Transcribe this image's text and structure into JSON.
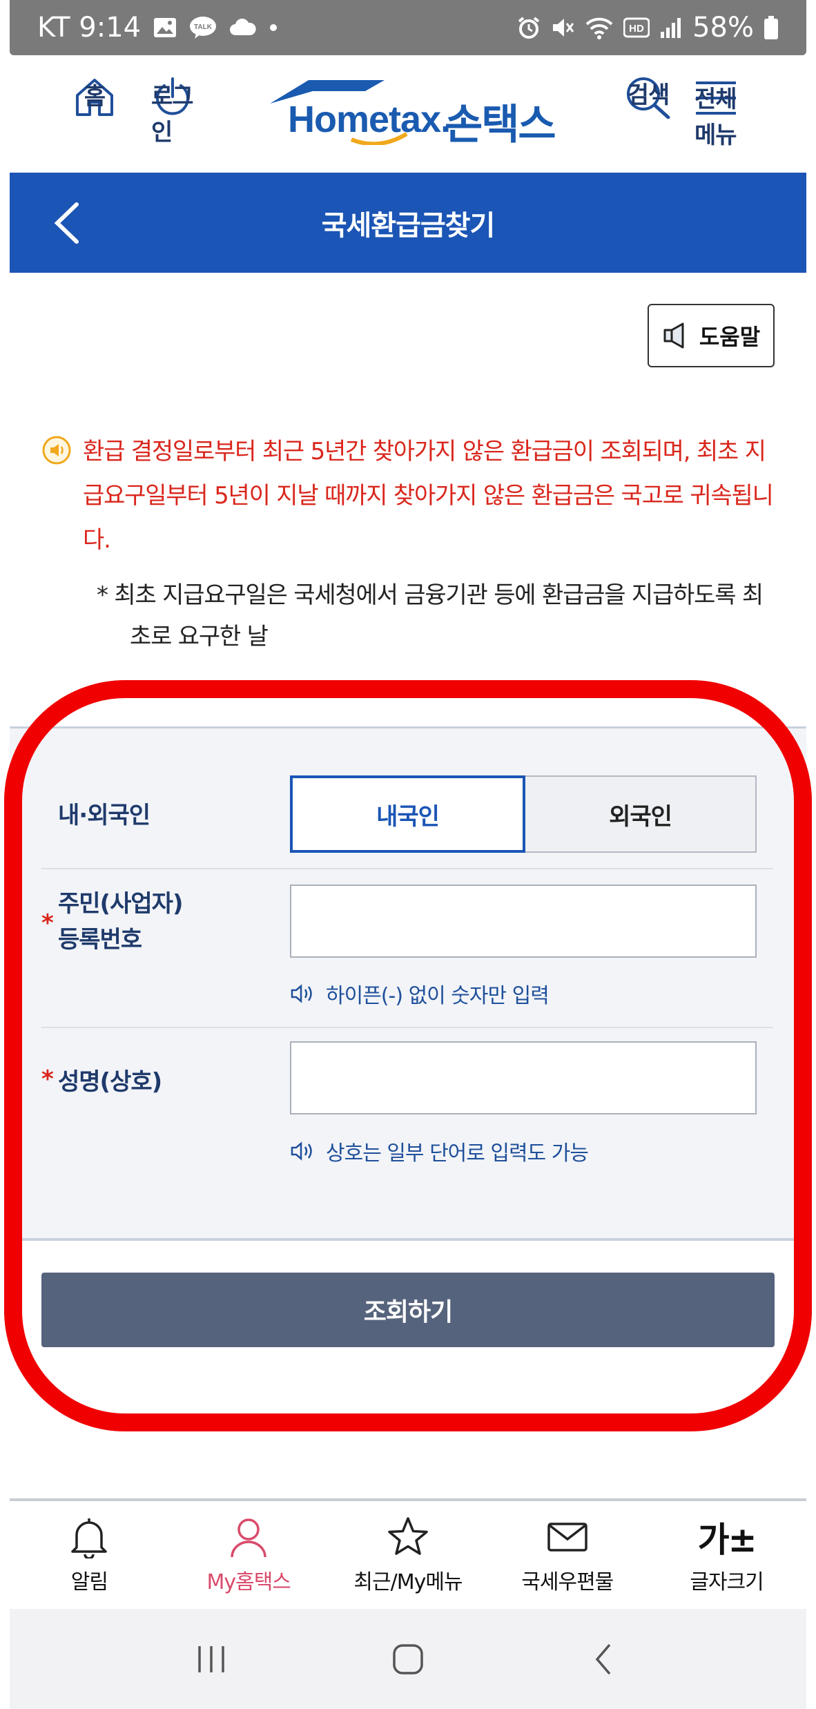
{
  "status_bar": {
    "carrier_time": "KT 9:14",
    "battery": "58%"
  },
  "header": {
    "home_label": "홈",
    "login_label": "로그인",
    "logo_text": "Hometax.",
    "logo_korean": "손택스",
    "search_label": "검색",
    "menu_label": "전체메뉴"
  },
  "title_bar": {
    "title": "국세환급금찾기"
  },
  "help": {
    "label": "도움말"
  },
  "notice": {
    "red_text": "환급 결정일로부터 최근 5년간 찾아가지 않은 환급금이 조회되며, 최초 지급요구일부터 5년이 지날 때까지 찾아가지 않은 환급금은 국고로 귀속됩니다.",
    "sub_line1": "* 최초 지급요구일은 국세청에서 금융기관 등에 환급금을 지급하도록 최",
    "sub_line2": "초로 요구한 날"
  },
  "form": {
    "nationality_label": "내·외국인",
    "domestic_label": "내국인",
    "foreign_label": "외국인",
    "selected": "내국인",
    "id_label_line1": "주민(사업자)",
    "id_label_line2": "등록번호",
    "id_value": "",
    "id_hint": "하이픈(-) 없이 숫자만 입력",
    "name_label": "성명(상호)",
    "name_value": "",
    "name_hint": "상호는 일부 단어로 입력도 가능",
    "required_mark": "*",
    "submit_label": "조회하기"
  },
  "bottom_nav": {
    "items": [
      {
        "label": "알림",
        "icon": "bell-icon"
      },
      {
        "label": "My홈택스",
        "icon": "person-icon",
        "active": true
      },
      {
        "label": "최근/My메뉴",
        "icon": "star-icon"
      },
      {
        "label": "국세우편물",
        "icon": "mail-icon"
      },
      {
        "label": "글자크기",
        "icon": "font-size-icon",
        "glyph": "가±"
      }
    ]
  },
  "colors": {
    "brand_blue": "#1b55b5",
    "notice_red": "#d9261c",
    "highlight_red": "#f00000",
    "submit_bg": "#56637c"
  }
}
